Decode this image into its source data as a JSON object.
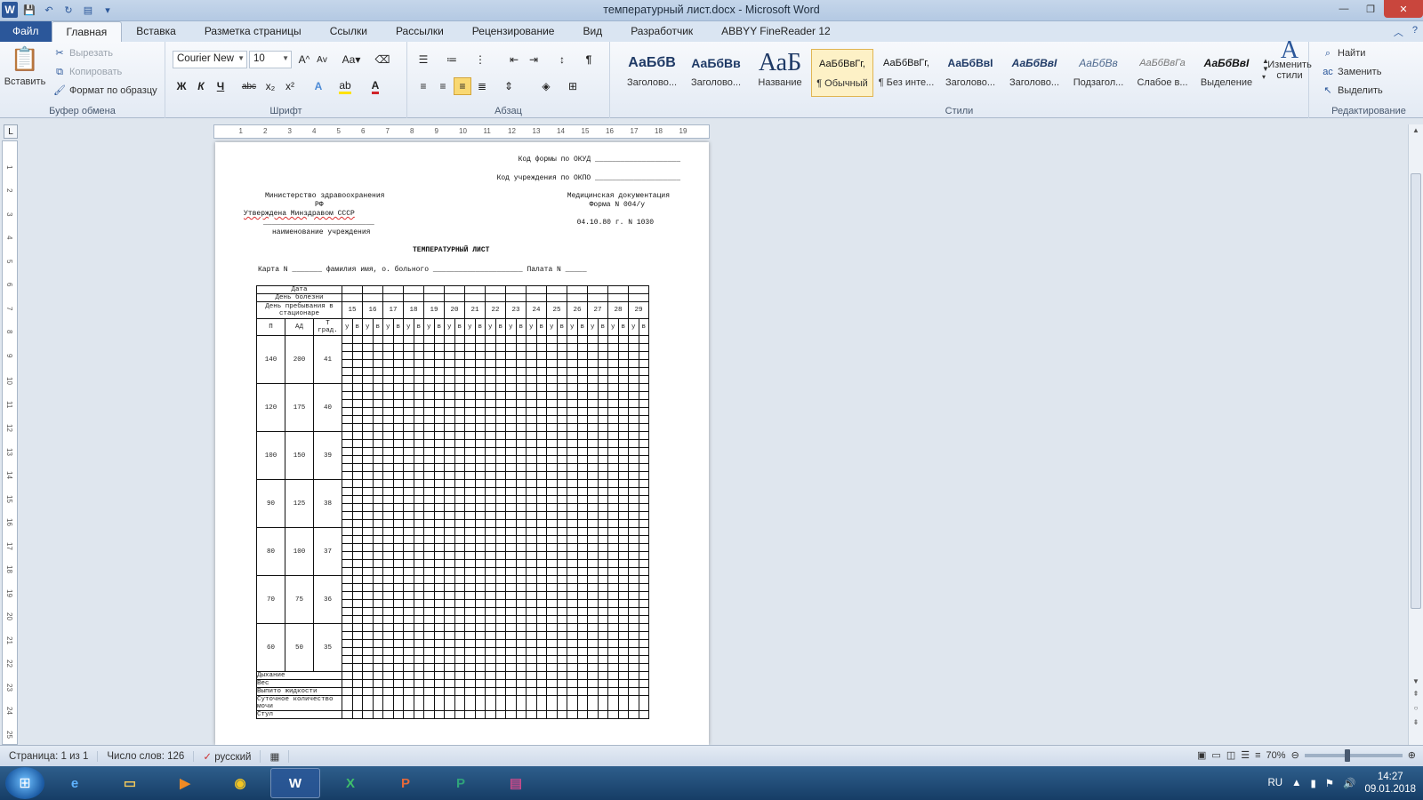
{
  "window": {
    "title": "температурный лист.docx - Microsoft Word",
    "minimize": "—",
    "maximize": "❐",
    "close": "✕"
  },
  "tabs": [
    "Файл",
    "Главная",
    "Вставка",
    "Разметка страницы",
    "Ссылки",
    "Рассылки",
    "Рецензирование",
    "Вид",
    "Разработчик",
    "ABBYY FineReader 12"
  ],
  "clipboard": {
    "paste": "Вставить",
    "cut": "Вырезать",
    "copy": "Копировать",
    "format": "Формат по образцу",
    "label": "Буфер обмена"
  },
  "font": {
    "name": "Courier New",
    "size": "10",
    "label": "Шрифт",
    "bold": "Ж",
    "italic": "К",
    "underline": "Ч",
    "strike": "abc",
    "sub": "x₂",
    "sup": "x²"
  },
  "paragraph": {
    "label": "Абзац"
  },
  "styles": {
    "label": "Стили",
    "items": [
      {
        "sample": "АаБбВ",
        "name": "Заголово..."
      },
      {
        "sample": "АаБбВв",
        "name": "Заголово..."
      },
      {
        "sample": "АаБ",
        "name": "Название"
      },
      {
        "sample": "АаБбВвГг,",
        "name": "¶ Обычный"
      },
      {
        "sample": "АаБбВвГг,",
        "name": "¶ Без инте..."
      },
      {
        "sample": "АаБбВвI",
        "name": "Заголово..."
      },
      {
        "sample": "АаБбВвI",
        "name": "Заголово..."
      },
      {
        "sample": "АаБбВв",
        "name": "Подзагол..."
      },
      {
        "sample": "АаБбВвГа",
        "name": "Слабое в..."
      },
      {
        "sample": "АаБбВвI",
        "name": "Выделение"
      }
    ],
    "change": "Изменить стили"
  },
  "editing": {
    "label": "Редактирование",
    "find": "Найти",
    "replace": "Заменить",
    "select": "Выделить"
  },
  "document": {
    "okud": "Код формы по ОКУД ____________________",
    "okpo": "Код учреждения по ОКПО ____________________",
    "ministry1": "Министерство здравоохранения",
    "ministry2": "РФ",
    "approved": "Утверждена Минздравом СССР",
    "meddoc": "Медицинская документация",
    "form": "Форма N 004/у",
    "date": "04.10.80 г. N 1030",
    "institution_line": "__________________________",
    "institution": "наименование учреждения",
    "heading": "ТЕМПЕРАТУРНЫЙ ЛИСТ",
    "card": "Карта N _______ фамилия имя, о. больного _____________________ Палата N _____",
    "table": {
      "row_date": "Дата",
      "row_illness": "День болезни",
      "row_stay": "День пребывания в стационаре",
      "days": [
        "15",
        "16",
        "17",
        "18",
        "19",
        "20",
        "21",
        "22",
        "23",
        "24",
        "25",
        "26",
        "27",
        "28",
        "29"
      ],
      "col_p": "П",
      "col_ad": "АД",
      "col_t": "Т град.",
      "uv": [
        "у",
        "в"
      ],
      "scale": [
        {
          "p": "140",
          "ad": "200",
          "t": "41"
        },
        {
          "p": "120",
          "ad": "175",
          "t": "40"
        },
        {
          "p": "100",
          "ad": "150",
          "t": "39"
        },
        {
          "p": "90",
          "ad": "125",
          "t": "38"
        },
        {
          "p": "80",
          "ad": "100",
          "t": "37"
        },
        {
          "p": "70",
          "ad": "75",
          "t": "36"
        },
        {
          "p": "60",
          "ad": "50",
          "t": "35"
        }
      ],
      "footer_rows": [
        "Дыхание",
        "Вес",
        "Выпито жидкости",
        "Суточное количество мочи",
        "Стул"
      ]
    }
  },
  "status": {
    "page": "Страница: 1 из 1",
    "words": "Число слов: 126",
    "lang": "русский",
    "zoom": "70%",
    "zoom_value": 70
  },
  "taskbar": {
    "lang": "RU",
    "time": "14:27",
    "date": "09.01.2018"
  }
}
